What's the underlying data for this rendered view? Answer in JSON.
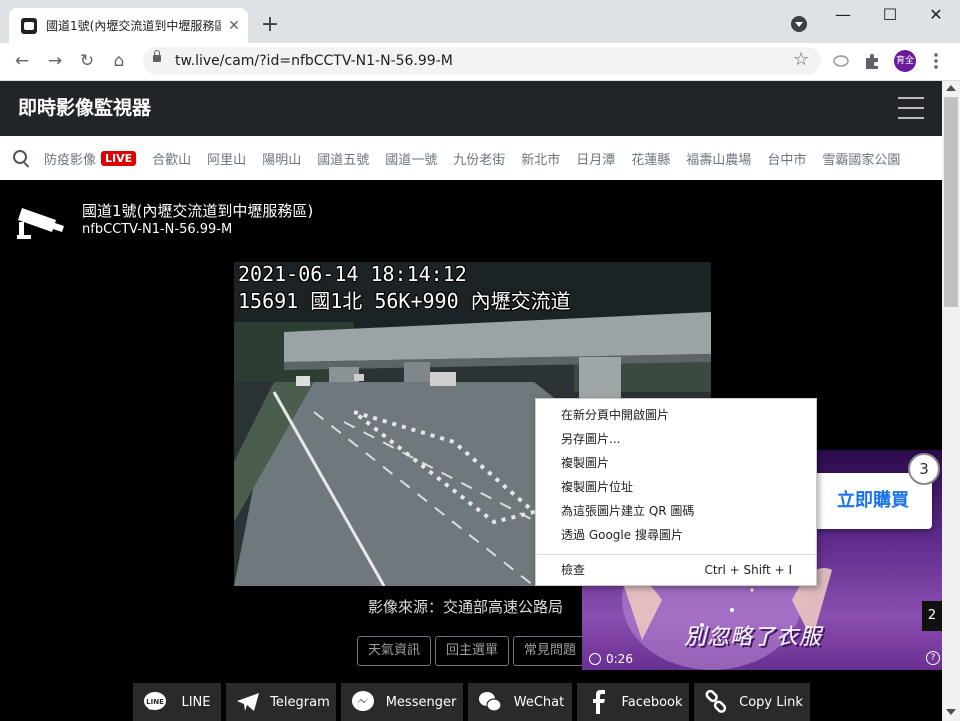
{
  "browser": {
    "tab_title": "國道1號(內壢交流道到中壢服務區",
    "tab_close": "✕",
    "new_tab": "+",
    "url": "tw.live/cam/?id=nfbCCTV-N1-N-56.99-M",
    "profile_label": "育全",
    "window_controls": {
      "minimize": "—",
      "maximize": "☐",
      "close": "✕"
    },
    "nav": {
      "back": "←",
      "forward": "→",
      "reload": "↻",
      "home": "⌂",
      "star": "☆"
    }
  },
  "site": {
    "title": "即時影像監視器",
    "categories": [
      {
        "label": "防疫影像",
        "badge": "LIVE"
      },
      {
        "label": "合歡山"
      },
      {
        "label": "阿里山"
      },
      {
        "label": "陽明山"
      },
      {
        "label": "國道五號"
      },
      {
        "label": "國道一號"
      },
      {
        "label": "九份老街"
      },
      {
        "label": "新北市"
      },
      {
        "label": "日月潭"
      },
      {
        "label": "花蓮縣"
      },
      {
        "label": "福壽山農場"
      },
      {
        "label": "台中市"
      },
      {
        "label": "雪霸國家公園"
      }
    ]
  },
  "camera": {
    "title": "國道1號(內壢交流道到中壢服務區)",
    "id": "nfbCCTV-N1-N-56.99-M",
    "overlay_time": "2021-06-14 18:14:12",
    "overlay_location": "15691 國1北 56K+990 內壢交流道",
    "source": "影像來源：交通部高速公路局"
  },
  "buttons": {
    "weather": "天氣資訊",
    "main_menu": "回主選單",
    "faq": "常見問題"
  },
  "share": [
    {
      "label": "LINE",
      "icon": "line-icon"
    },
    {
      "label": "Telegram",
      "icon": "telegram-icon"
    },
    {
      "label": "Messenger",
      "icon": "messenger-icon"
    },
    {
      "label": "WeChat",
      "icon": "wechat-icon"
    },
    {
      "label": "Facebook",
      "icon": "facebook-icon"
    },
    {
      "label": "Copy Link",
      "icon": "link-icon"
    }
  ],
  "ad": {
    "buy_label": "立即購買",
    "count": "3",
    "caption": "別忽略了衣服",
    "time": "0:26",
    "skip": "2",
    "help": "?"
  },
  "context_menu": {
    "items": [
      "在新分頁中開啟圖片",
      "另存圖片...",
      "複製圖片",
      "複製圖片位址",
      "為這張圖片建立 QR 圖碼",
      "透過 Google 搜尋圖片"
    ],
    "inspect": "檢查",
    "inspect_shortcut": "Ctrl + Shift + I"
  }
}
